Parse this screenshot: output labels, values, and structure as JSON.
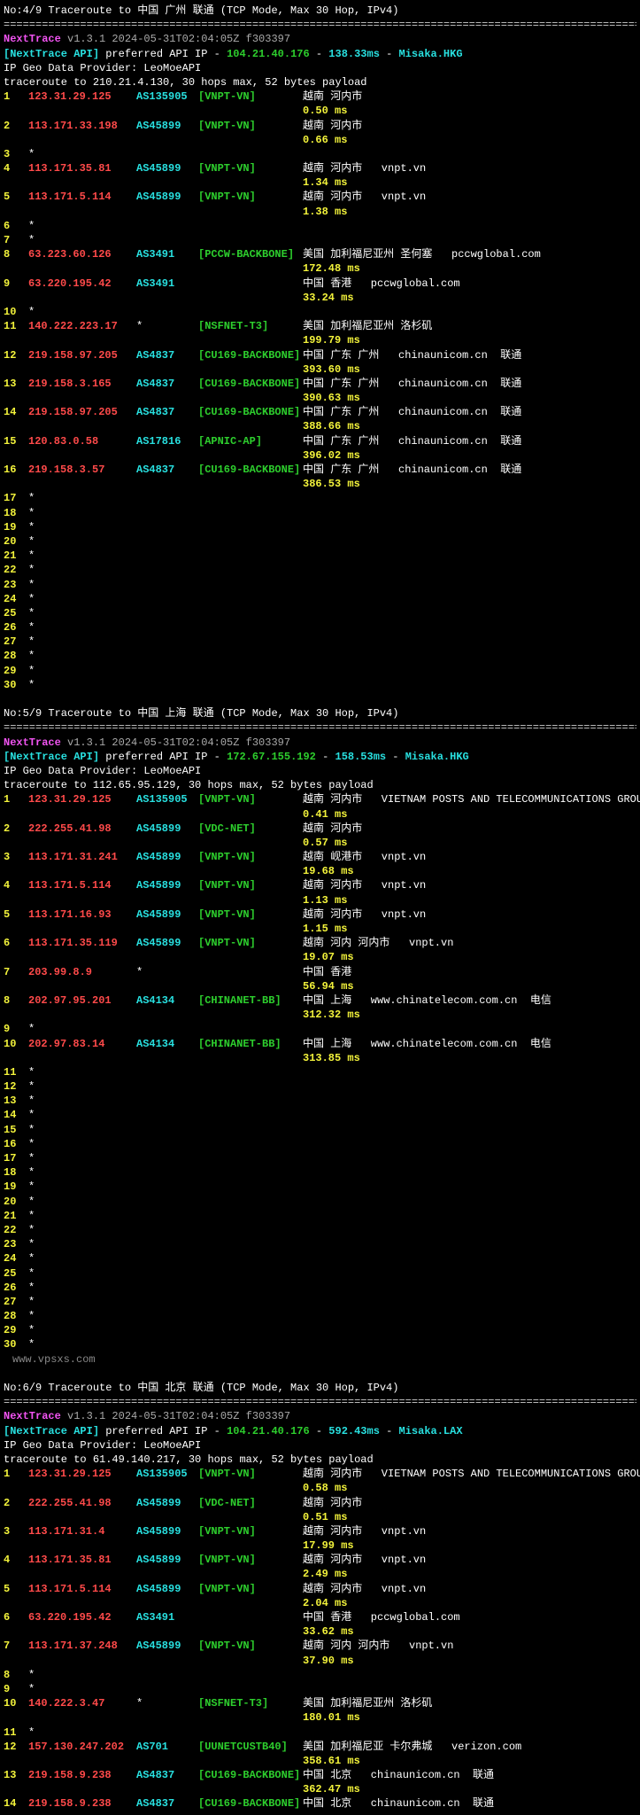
{
  "sep": "============================================================================================================",
  "watermark": "www.vpsxs.com",
  "traces": [
    {
      "title": "No:4/9 Traceroute to 中国 广州 联通 (TCP Mode, Max 30 Hop, IPv4)",
      "header": {
        "app": "NextTrace",
        "ver": "v1.3.1 2024-05-31T02:04:05Z f303397",
        "api_label": "[NextTrace API]",
        "api_text": " preferred API IP - ",
        "api_ip": "104.21.40.176",
        "api_ms": "138.33ms",
        "api_src": "Misaka.HKG",
        "geo": "IP Geo Data Provider: LeoMoeAPI",
        "route": "traceroute to 210.21.4.130, 30 hops max, 52 bytes payload"
      },
      "hops": [
        {
          "n": "1",
          "ip": "123.31.29.125",
          "asn": "AS135905",
          "bb": "[VNPT-VN]",
          "loc": "越南 河内市",
          "ms": "0.50 ms",
          "ipc": "red-b",
          "asnc": "cyan-b",
          "bbc": "green-b",
          "locc": "white"
        },
        {
          "n": "2",
          "ip": "113.171.33.198",
          "asn": "AS45899",
          "bb": "[VNPT-VN]",
          "loc": "越南 河内市",
          "ms": "0.66 ms",
          "ipc": "red-b",
          "asnc": "cyan-b",
          "bbc": "green-b",
          "locc": "white"
        },
        {
          "n": "3",
          "ip": "*"
        },
        {
          "n": "4",
          "ip": "113.171.35.81",
          "asn": "AS45899",
          "bb": "[VNPT-VN]",
          "loc": "越南 河内市   vnpt.vn",
          "ms": "1.34 ms",
          "ipc": "red-b",
          "asnc": "cyan-b",
          "bbc": "green-b",
          "locc": "white"
        },
        {
          "n": "5",
          "ip": "113.171.5.114",
          "asn": "AS45899",
          "bb": "[VNPT-VN]",
          "loc": "越南 河内市   vnpt.vn",
          "ms": "1.38 ms",
          "ipc": "red-b",
          "asnc": "cyan-b",
          "bbc": "green-b",
          "locc": "white"
        },
        {
          "n": "6",
          "ip": "*"
        },
        {
          "n": "7",
          "ip": "*"
        },
        {
          "n": "8",
          "ip": "63.223.60.126",
          "asn": "AS3491",
          "bb": "[PCCW-BACKBONE]",
          "loc": "美国 加利福尼亚州 圣何塞   pccwglobal.com",
          "ms": "172.48 ms",
          "ipc": "red-b",
          "asnc": "cyan-b",
          "bbc": "green-b",
          "locc": "white"
        },
        {
          "n": "9",
          "ip": "63.220.195.42",
          "asn": "AS3491",
          "bb": "",
          "loc": "中国 香港   pccwglobal.com",
          "ms": "33.24 ms",
          "ipc": "red-b",
          "asnc": "cyan-b",
          "bbc": "green-b",
          "locc": "white"
        },
        {
          "n": "10",
          "ip": "*"
        },
        {
          "n": "11",
          "ip": "140.222.223.17",
          "asn": "*",
          "bb": "[NSFNET-T3]",
          "loc": "美国 加利福尼亚州 洛杉矶",
          "ms": "199.79 ms",
          "ipc": "red-b",
          "asnc": "white",
          "bbc": "green-b",
          "locc": "white"
        },
        {
          "n": "12",
          "ip": "219.158.97.205",
          "asn": "AS4837",
          "bb": "[CU169-BACKBONE]",
          "loc": "中国 广东 广州   chinaunicom.cn  联通",
          "ms": "393.60 ms",
          "ipc": "red-b",
          "asnc": "cyan-b",
          "bbc": "green-b",
          "locc": "white"
        },
        {
          "n": "13",
          "ip": "219.158.3.165",
          "asn": "AS4837",
          "bb": "[CU169-BACKBONE]",
          "loc": "中国 广东 广州   chinaunicom.cn  联通",
          "ms": "390.63 ms",
          "ipc": "red-b",
          "asnc": "cyan-b",
          "bbc": "green-b",
          "locc": "white"
        },
        {
          "n": "14",
          "ip": "219.158.97.205",
          "asn": "AS4837",
          "bb": "[CU169-BACKBONE]",
          "loc": "中国 广东 广州   chinaunicom.cn  联通",
          "ms": "388.66 ms",
          "ipc": "red-b",
          "asnc": "cyan-b",
          "bbc": "green-b",
          "locc": "white"
        },
        {
          "n": "15",
          "ip": "120.83.0.58",
          "asn": "AS17816",
          "bb": "[APNIC-AP]",
          "loc": "中国 广东 广州   chinaunicom.cn  联通",
          "ms": "396.02 ms",
          "ipc": "red-b",
          "asnc": "cyan-b",
          "bbc": "green-b",
          "locc": "white"
        },
        {
          "n": "16",
          "ip": "219.158.3.57",
          "asn": "AS4837",
          "bb": "[CU169-BACKBONE]",
          "loc": "中国 广东 广州   chinaunicom.cn  联通",
          "ms": "386.53 ms",
          "ipc": "red-b",
          "asnc": "cyan-b",
          "bbc": "green-b",
          "locc": "white"
        },
        {
          "n": "17",
          "ip": "*"
        },
        {
          "n": "18",
          "ip": "*"
        },
        {
          "n": "19",
          "ip": "*"
        },
        {
          "n": "20",
          "ip": "*"
        },
        {
          "n": "21",
          "ip": "*"
        },
        {
          "n": "22",
          "ip": "*"
        },
        {
          "n": "23",
          "ip": "*"
        },
        {
          "n": "24",
          "ip": "*"
        },
        {
          "n": "25",
          "ip": "*"
        },
        {
          "n": "26",
          "ip": "*"
        },
        {
          "n": "27",
          "ip": "*"
        },
        {
          "n": "28",
          "ip": "*"
        },
        {
          "n": "29",
          "ip": "*"
        },
        {
          "n": "30",
          "ip": "*"
        }
      ]
    },
    {
      "title": "No:5/9 Traceroute to 中国 上海 联通 (TCP Mode, Max 30 Hop, IPv4)",
      "header": {
        "app": "NextTrace",
        "ver": "v1.3.1 2024-05-31T02:04:05Z f303397",
        "api_label": "[NextTrace API]",
        "api_text": " preferred API IP - ",
        "api_ip": "172.67.155.192",
        "api_ms": "158.53ms",
        "api_src": "Misaka.HKG",
        "geo": "IP Geo Data Provider: LeoMoeAPI",
        "route": "traceroute to 112.65.95.129, 30 hops max, 52 bytes payload"
      },
      "hops": [
        {
          "n": "1",
          "ip": "123.31.29.125",
          "asn": "AS135905",
          "bb": "[VNPT-VN]",
          "loc": "越南 河内市   VIETNAM POSTS AND TELECOMMUNICATIONS GROUP",
          "ms": "0.41 ms",
          "ipc": "red-b",
          "asnc": "cyan-b",
          "bbc": "green-b",
          "locc": "white"
        },
        {
          "n": "2",
          "ip": "222.255.41.98",
          "asn": "AS45899",
          "bb": "[VDC-NET]",
          "loc": "越南 河内市",
          "ms": "0.57 ms",
          "ipc": "red-b",
          "asnc": "cyan-b",
          "bbc": "green-b",
          "locc": "white"
        },
        {
          "n": "3",
          "ip": "113.171.31.241",
          "asn": "AS45899",
          "bb": "[VNPT-VN]",
          "loc": "越南 岘港市   vnpt.vn",
          "ms": "19.68 ms",
          "ipc": "red-b",
          "asnc": "cyan-b",
          "bbc": "green-b",
          "locc": "white"
        },
        {
          "n": "4",
          "ip": "113.171.5.114",
          "asn": "AS45899",
          "bb": "[VNPT-VN]",
          "loc": "越南 河内市   vnpt.vn",
          "ms": "1.13 ms",
          "ipc": "red-b",
          "asnc": "cyan-b",
          "bbc": "green-b",
          "locc": "white"
        },
        {
          "n": "5",
          "ip": "113.171.16.93",
          "asn": "AS45899",
          "bb": "[VNPT-VN]",
          "loc": "越南 河内市   vnpt.vn",
          "ms": "1.15 ms",
          "ipc": "red-b",
          "asnc": "cyan-b",
          "bbc": "green-b",
          "locc": "white"
        },
        {
          "n": "6",
          "ip": "113.171.35.119",
          "asn": "AS45899",
          "bb": "[VNPT-VN]",
          "loc": "越南 河内 河内市   vnpt.vn",
          "ms": "19.07 ms",
          "ipc": "red-b",
          "asnc": "cyan-b",
          "bbc": "green-b",
          "locc": "white"
        },
        {
          "n": "7",
          "ip": "203.99.8.9",
          "asn": "*",
          "bb": "",
          "loc": "中国 香港",
          "ms": "56.94 ms",
          "ipc": "red-b",
          "asnc": "white",
          "bbc": "green-b",
          "locc": "white"
        },
        {
          "n": "8",
          "ip": "202.97.95.201",
          "asn": "AS4134",
          "bb": "[CHINANET-BB]",
          "loc": "中国 上海   www.chinatelecom.com.cn  电信",
          "ms": "312.32 ms",
          "ipc": "red-b",
          "asnc": "cyan-b",
          "bbc": "green-b",
          "locc": "white"
        },
        {
          "n": "9",
          "ip": "*"
        },
        {
          "n": "10",
          "ip": "202.97.83.14",
          "asn": "AS4134",
          "bb": "[CHINANET-BB]",
          "loc": "中国 上海   www.chinatelecom.com.cn  电信",
          "ms": "313.85 ms",
          "ipc": "red-b",
          "asnc": "cyan-b",
          "bbc": "green-b",
          "locc": "white"
        },
        {
          "n": "11",
          "ip": "*"
        },
        {
          "n": "12",
          "ip": "*"
        },
        {
          "n": "13",
          "ip": "*"
        },
        {
          "n": "14",
          "ip": "*"
        },
        {
          "n": "15",
          "ip": "*"
        },
        {
          "n": "16",
          "ip": "*"
        },
        {
          "n": "17",
          "ip": "*"
        },
        {
          "n": "18",
          "ip": "*"
        },
        {
          "n": "19",
          "ip": "*"
        },
        {
          "n": "20",
          "ip": "*"
        },
        {
          "n": "21",
          "ip": "*"
        },
        {
          "n": "22",
          "ip": "*"
        },
        {
          "n": "23",
          "ip": "*"
        },
        {
          "n": "24",
          "ip": "*"
        },
        {
          "n": "25",
          "ip": "*"
        },
        {
          "n": "26",
          "ip": "*"
        },
        {
          "n": "27",
          "ip": "*"
        },
        {
          "n": "28",
          "ip": "*"
        },
        {
          "n": "29",
          "ip": "*"
        },
        {
          "n": "30",
          "ip": "*"
        }
      ],
      "watermark": true
    },
    {
      "title": "No:6/9 Traceroute to 中国 北京 联通 (TCP Mode, Max 30 Hop, IPv4)",
      "header": {
        "app": "NextTrace",
        "ver": "v1.3.1 2024-05-31T02:04:05Z f303397",
        "api_label": "[NextTrace API]",
        "api_text": " preferred API IP - ",
        "api_ip": "104.21.40.176",
        "api_ms": "592.43ms",
        "api_src": "Misaka.LAX",
        "geo": "IP Geo Data Provider: LeoMoeAPI",
        "route": "traceroute to 61.49.140.217, 30 hops max, 52 bytes payload"
      },
      "hops": [
        {
          "n": "1",
          "ip": "123.31.29.125",
          "asn": "AS135905",
          "bb": "[VNPT-VN]",
          "loc": "越南 河内市   VIETNAM POSTS AND TELECOMMUNICATIONS GROUP",
          "ms": "0.58 ms",
          "ipc": "red-b",
          "asnc": "cyan-b",
          "bbc": "green-b",
          "locc": "white"
        },
        {
          "n": "2",
          "ip": "222.255.41.98",
          "asn": "AS45899",
          "bb": "[VDC-NET]",
          "loc": "越南 河内市",
          "ms": "0.51 ms",
          "ipc": "red-b",
          "asnc": "cyan-b",
          "bbc": "green-b",
          "locc": "white"
        },
        {
          "n": "3",
          "ip": "113.171.31.4",
          "asn": "AS45899",
          "bb": "[VNPT-VN]",
          "loc": "越南 河内市   vnpt.vn",
          "ms": "17.99 ms",
          "ipc": "red-b",
          "asnc": "cyan-b",
          "bbc": "green-b",
          "locc": "white"
        },
        {
          "n": "4",
          "ip": "113.171.35.81",
          "asn": "AS45899",
          "bb": "[VNPT-VN]",
          "loc": "越南 河内市   vnpt.vn",
          "ms": "2.49 ms",
          "ipc": "red-b",
          "asnc": "cyan-b",
          "bbc": "green-b",
          "locc": "white"
        },
        {
          "n": "5",
          "ip": "113.171.5.114",
          "asn": "AS45899",
          "bb": "[VNPT-VN]",
          "loc": "越南 河内市   vnpt.vn",
          "ms": "2.04 ms",
          "ipc": "red-b",
          "asnc": "cyan-b",
          "bbc": "green-b",
          "locc": "white"
        },
        {
          "n": "6",
          "ip": "63.220.195.42",
          "asn": "AS3491",
          "bb": "",
          "loc": "中国 香港   pccwglobal.com",
          "ms": "33.62 ms",
          "ipc": "red-b",
          "asnc": "cyan-b",
          "bbc": "green-b",
          "locc": "white"
        },
        {
          "n": "7",
          "ip": "113.171.37.248",
          "asn": "AS45899",
          "bb": "[VNPT-VN]",
          "loc": "越南 河内 河内市   vnpt.vn",
          "ms": "37.90 ms",
          "ipc": "red-b",
          "asnc": "cyan-b",
          "bbc": "green-b",
          "locc": "white"
        },
        {
          "n": "8",
          "ip": "*"
        },
        {
          "n": "9",
          "ip": "*"
        },
        {
          "n": "10",
          "ip": "140.222.3.47",
          "asn": "*",
          "bb": "[NSFNET-T3]",
          "loc": "美国 加利福尼亚州 洛杉矶",
          "ms": "180.01 ms",
          "ipc": "red-b",
          "asnc": "white",
          "bbc": "green-b",
          "locc": "white"
        },
        {
          "n": "11",
          "ip": "*"
        },
        {
          "n": "12",
          "ip": "157.130.247.202",
          "asn": "AS701",
          "bb": "[UUNETCUSTB40]",
          "loc": "美国 加利福尼亚 卡尔弗城   verizon.com",
          "ms": "358.61 ms",
          "ipc": "red-b",
          "asnc": "cyan-b",
          "bbc": "green-b",
          "locc": "white"
        },
        {
          "n": "13",
          "ip": "219.158.9.238",
          "asn": "AS4837",
          "bb": "[CU169-BACKBONE]",
          "loc": "中国 北京   chinaunicom.cn  联通",
          "ms": "362.47 ms",
          "ipc": "red-b",
          "asnc": "cyan-b",
          "bbc": "green-b",
          "locc": "white"
        },
        {
          "n": "14",
          "ip": "219.158.9.238",
          "asn": "AS4837",
          "bb": "[CU169-BACKBONE]",
          "loc": "中国 北京   chinaunicom.cn  联通",
          "ms": "",
          "ipc": "red-b",
          "asnc": "cyan-b",
          "bbc": "green-b",
          "locc": "white"
        }
      ]
    }
  ]
}
